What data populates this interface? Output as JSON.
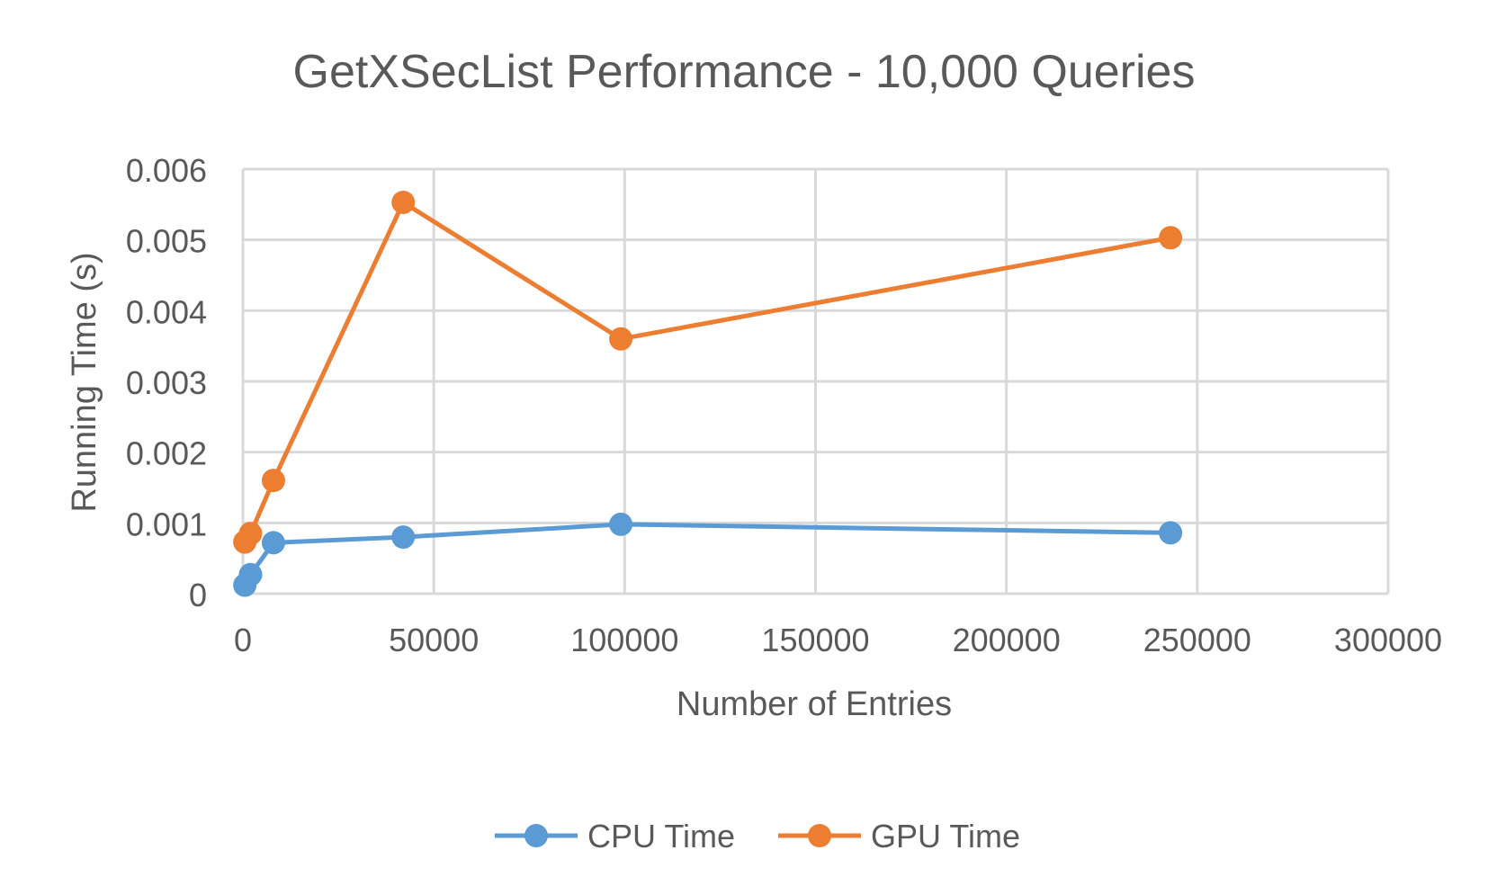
{
  "chart_data": {
    "type": "line",
    "title": "GetXSecList Performance - 10,000 Queries",
    "xlabel": "Number of Entries",
    "ylabel": "Running Time (s)",
    "xlim": [
      0,
      300000
    ],
    "ylim": [
      0,
      0.006
    ],
    "x_ticks": [
      0,
      50000,
      100000,
      150000,
      200000,
      250000,
      300000
    ],
    "x_tick_labels": [
      "0",
      "50000",
      "100000",
      "150000",
      "200000",
      "250000",
      "300000"
    ],
    "y_ticks": [
      0,
      0.001,
      0.002,
      0.003,
      0.004,
      0.005,
      0.006
    ],
    "y_tick_labels": [
      "0",
      "0.001",
      "0.002",
      "0.003",
      "0.004",
      "0.005",
      "0.006"
    ],
    "grid": true,
    "legend_position": "bottom",
    "series": [
      {
        "name": "CPU Time",
        "color": "#5B9BD5",
        "points": [
          [
            500,
            0.00012
          ],
          [
            2000,
            0.00027
          ],
          [
            8000,
            0.00072
          ],
          [
            42000,
            0.0008
          ],
          [
            99000,
            0.00098
          ],
          [
            243000,
            0.00086
          ]
        ]
      },
      {
        "name": "GPU Time",
        "color": "#ED7D31",
        "points": [
          [
            500,
            0.00073
          ],
          [
            2000,
            0.00085
          ],
          [
            8000,
            0.0016
          ],
          [
            42000,
            0.00553
          ],
          [
            99000,
            0.0036
          ],
          [
            243000,
            0.00503
          ]
        ]
      }
    ]
  }
}
